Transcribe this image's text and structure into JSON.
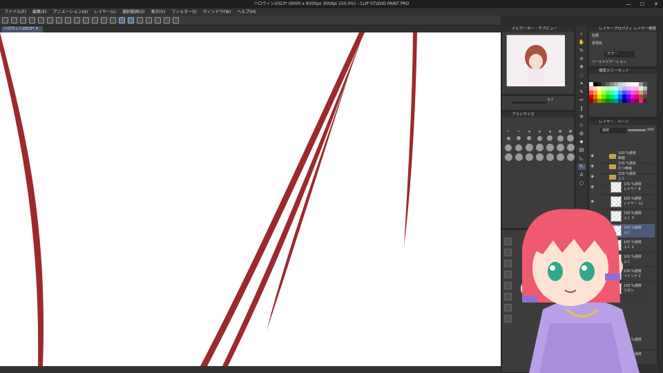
{
  "window": {
    "title": "ハロウィン2023* (9000 x 9000px 300dpi 150.0%) - CLIP STUDIO PAINT PRO",
    "min": "—",
    "max": "☐",
    "close": "✕"
  },
  "menu": [
    "ファイル(F)",
    "編集(E)",
    "アニメーション(A)",
    "レイヤー(L)",
    "選択範囲(S)",
    "表示(V)",
    "フィルター(I)",
    "ウィンドウ(W)",
    "ヘルプ(H)"
  ],
  "document_tab": "ハロウィン2023*",
  "navigator": {
    "tab1": "ナビゲーター",
    "tab2": "サブビュー",
    "zoom": "5.7"
  },
  "brush_size_panel": {
    "title": "ブラシサイズ",
    "sizes": [
      "0.7",
      "1",
      "1.5",
      "2",
      "2.5",
      "3",
      "4",
      "5",
      "6",
      "7",
      "8",
      "10",
      "12",
      "15"
    ]
  },
  "tool_property": {
    "tab1": "レイヤープロパティ",
    "tab2": "レイヤー検索",
    "effect_label": "効果",
    "display_color_label": "表現色",
    "display_color_value": "カラー",
    "tool_nav_label": "ツールナビゲーション"
  },
  "color_set": {
    "title": "標準カラーセット"
  },
  "layer_panel": {
    "tab1": "レイヤー",
    "tab2": "ページ",
    "blend_mode": "通常",
    "opacity": "100"
  },
  "layers": [
    {
      "name": "線画",
      "mode": "100 %通常",
      "type": "folder"
    },
    {
      "name": "たつ線画",
      "mode": "100 %通常",
      "type": "folder"
    },
    {
      "name": "ふく",
      "mode": "100 %通常",
      "type": "folder"
    },
    {
      "name": "レイヤー 8",
      "mode": "100 %通常",
      "type": "layer"
    },
    {
      "name": "レイヤー 12",
      "mode": "100 %通常",
      "type": "layer"
    },
    {
      "name": "ふく 3",
      "mode": "100 %通常",
      "type": "layer"
    },
    {
      "name": "ふく",
      "mode": "100 %通常",
      "type": "layer",
      "selected": true
    },
    {
      "name": "ふく 2",
      "mode": "100 %通常",
      "type": "layer"
    },
    {
      "name": "ふく",
      "mode": "100 %通常",
      "type": "layer"
    },
    {
      "name": "ツインテ 2",
      "mode": "100 %通常",
      "type": "layer"
    },
    {
      "name": "リボン",
      "mode": "100 %通常",
      "type": "layer"
    },
    {
      "name": "かみ",
      "mode": "100 %通常",
      "type": "layer"
    },
    {
      "name": "ピアス",
      "mode": "100 %通常",
      "type": "layer"
    }
  ],
  "colors": {
    "stroke": "#9b2a2e",
    "accent": "#4b5a78",
    "canvas": "#ffffff"
  }
}
